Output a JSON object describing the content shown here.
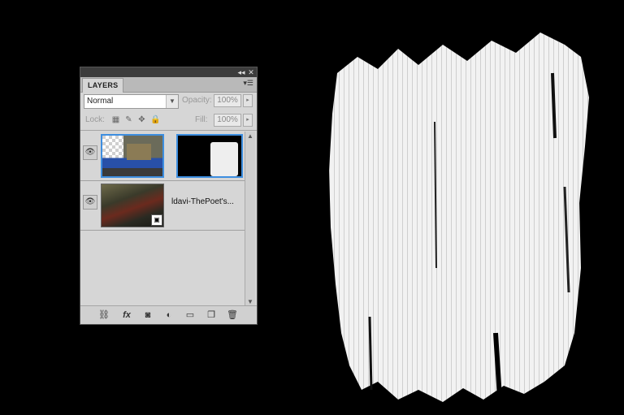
{
  "panel": {
    "tab_label": "LAYERS",
    "collapse_icon": "double-chevron",
    "close_icon": "close",
    "blend_mode": "Normal",
    "opacity_label": "Opacity:",
    "opacity_value": "100%",
    "lock_label": "Lock:",
    "fill_label": "Fill:",
    "fill_value": "100%"
  },
  "layers": [
    {
      "name": "",
      "selected": true,
      "has_mask": true
    },
    {
      "name": "ldavi-ThePoet's...",
      "selected": false,
      "has_mask": false,
      "smart_object": true
    }
  ],
  "bottom_buttons": [
    "link-layers",
    "layer-style",
    "add-mask",
    "adjustment-layer",
    "new-group",
    "new-layer",
    "delete-layer"
  ],
  "colors": {
    "panel_bg": "#d6d6d6",
    "selection": "#3d8ee0",
    "canvas_bg": "#000000"
  }
}
